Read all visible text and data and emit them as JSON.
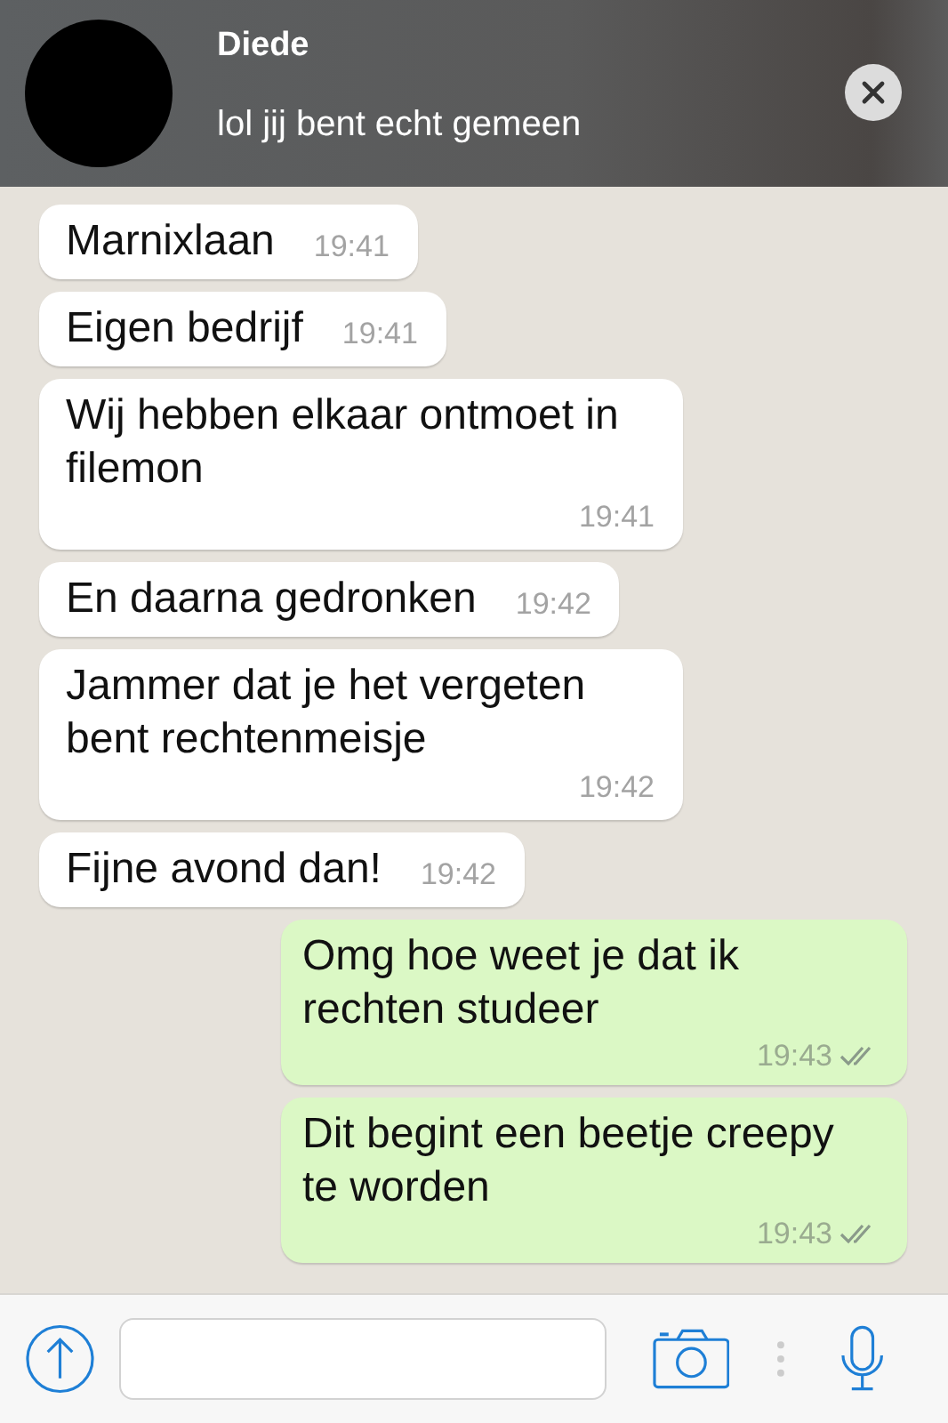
{
  "notification": {
    "sender": "Diede",
    "text": "lol jij bent echt gemeen"
  },
  "messages": [
    {
      "kind": "in",
      "text": "Marnixlaan",
      "time": "19:41"
    },
    {
      "kind": "in",
      "text": "Eigen bedrijf",
      "time": "19:41"
    },
    {
      "kind": "in",
      "text": "Wij hebben elkaar ontmoet in filemon",
      "time": "19:41"
    },
    {
      "kind": "in",
      "text": "En daarna gedronken",
      "time": "19:42"
    },
    {
      "kind": "in",
      "text": "Jammer dat je het vergeten bent rechtenmeisje",
      "time": "19:42"
    },
    {
      "kind": "in",
      "text": "Fijne avond dan!",
      "time": "19:42"
    },
    {
      "kind": "out",
      "text": "Omg hoe weet je dat ik rechten studeer",
      "time": "19:43",
      "read": true
    },
    {
      "kind": "out",
      "text": "Dit begint een beetje creepy te worden",
      "time": "19:43",
      "read": true
    }
  ]
}
